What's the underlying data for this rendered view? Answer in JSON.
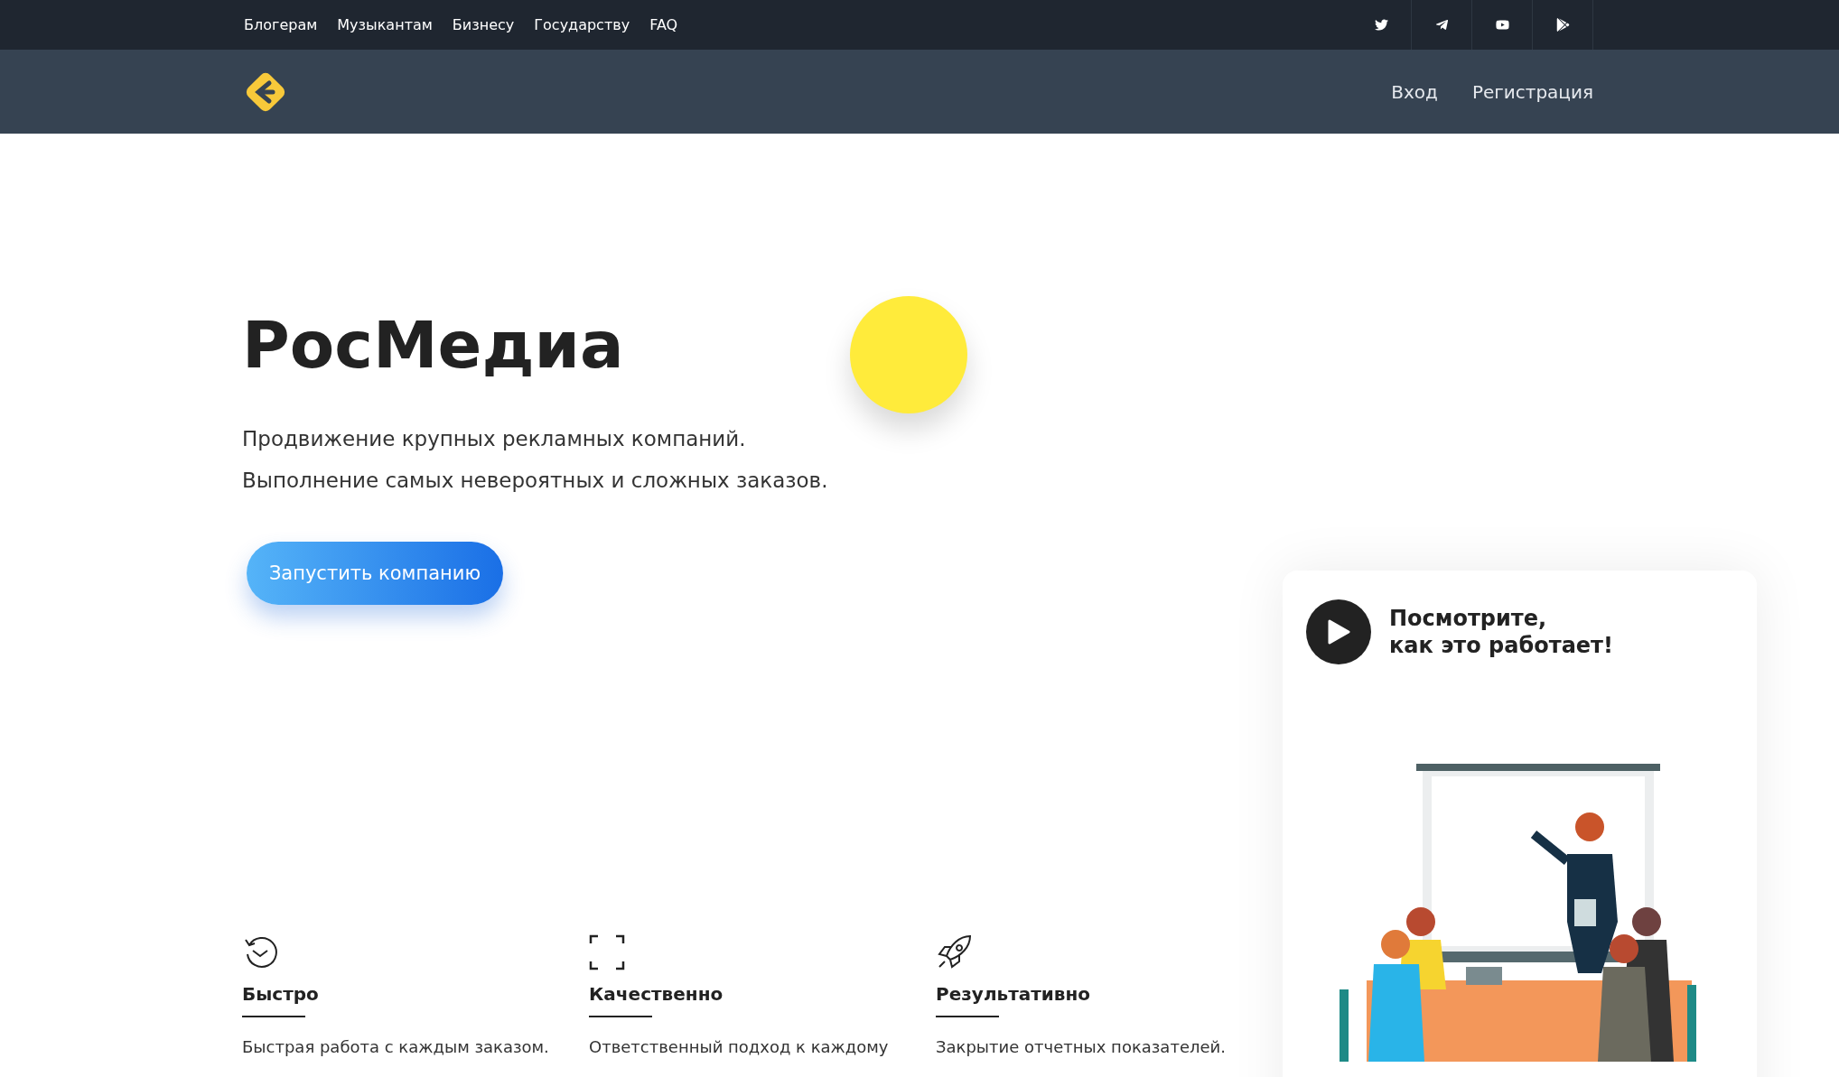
{
  "top_nav": {
    "links": [
      "Блогерам",
      "Музыкантам",
      "Бизнесу",
      "Государству",
      "FAQ"
    ]
  },
  "header": {
    "login": "Вход",
    "register": "Регистрация"
  },
  "hero": {
    "title": "РосМедиа",
    "lines": [
      "Продвижение крупных рекламных компаний.",
      "Выполнение самых невероятных и сложных заказов."
    ],
    "button": "Запустить компанию"
  },
  "video_card": {
    "title_lines": [
      "Посмотрите,",
      "как это работает!"
    ]
  },
  "features": [
    {
      "kind": "clock",
      "title": "Быстро",
      "text": "Быстрая работа с каждым заказом."
    },
    {
      "kind": "frame",
      "title": "Качественно",
      "text": "Ответственный подход к каждому"
    },
    {
      "kind": "rocket",
      "title": "Результативно",
      "text": "Закрытие отчетных показателей."
    }
  ]
}
